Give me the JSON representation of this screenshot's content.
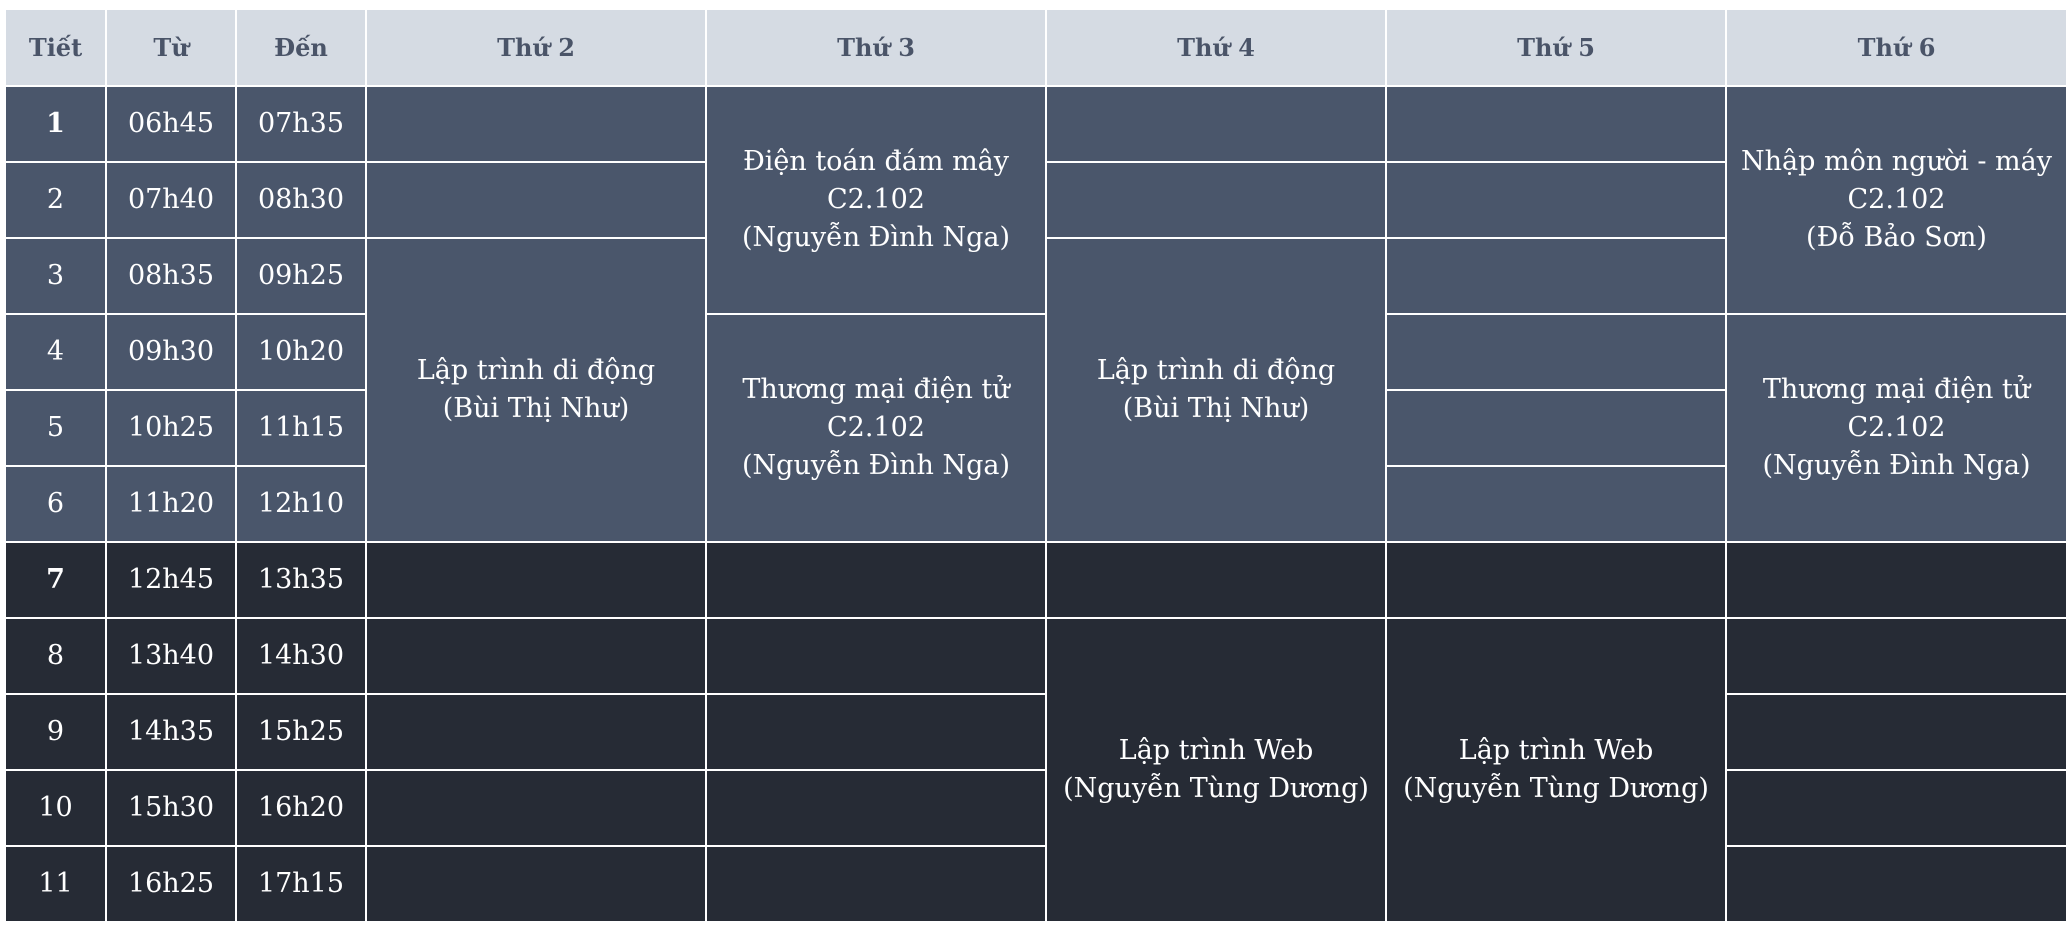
{
  "headers": [
    "Tiết",
    "Từ",
    "Đến",
    "Thứ 2",
    "Thứ 3",
    "Thứ 4",
    "Thứ 5",
    "Thứ 6"
  ],
  "periods": [
    {
      "no": "1",
      "from": "06h45",
      "to": "07h35"
    },
    {
      "no": "2",
      "from": "07h40",
      "to": "08h30"
    },
    {
      "no": "3",
      "from": "08h35",
      "to": "09h25"
    },
    {
      "no": "4",
      "from": "09h30",
      "to": "10h20"
    },
    {
      "no": "5",
      "from": "10h25",
      "to": "11h15"
    },
    {
      "no": "6",
      "from": "11h20",
      "to": "12h10"
    },
    {
      "no": "7",
      "from": "12h45",
      "to": "13h35"
    },
    {
      "no": "8",
      "from": "13h40",
      "to": "14h30"
    },
    {
      "no": "9",
      "from": "14h35",
      "to": "15h25"
    },
    {
      "no": "10",
      "from": "15h30",
      "to": "16h20"
    },
    {
      "no": "11",
      "from": "16h25",
      "to": "17h15"
    }
  ],
  "courses": {
    "mon_mobile": {
      "name": "Lập trình di động",
      "teacher": "(Bùi Thị Như)"
    },
    "tue_cloud": {
      "name": "Điện toán đám mây",
      "room": "C2.102",
      "teacher": "(Nguyễn Đình Nga)"
    },
    "tue_ecom": {
      "name": "Thương mại điện tử",
      "room": "C2.102",
      "teacher": "(Nguyễn Đình Nga)"
    },
    "wed_mobile": {
      "name": "Lập trình di động",
      "teacher": "(Bùi Thị Như)"
    },
    "wed_web": {
      "name": "Lập trình Web",
      "teacher": "(Nguyễn Tùng Dương)"
    },
    "thu_web": {
      "name": "Lập trình Web",
      "teacher": "(Nguyễn Tùng Dương)"
    },
    "fri_hci": {
      "name": "Nhập môn người - máy",
      "room": "C2.102",
      "teacher": "(Đỗ Bảo Sơn)"
    },
    "fri_ecom": {
      "name": "Thương mại điện tử",
      "room": "C2.102",
      "teacher": "(Nguyễn Đình Nga)"
    }
  },
  "colors": {
    "header_bg": "#d5dbe3",
    "header_text": "#4a5468",
    "morning_bg": "#4a566b",
    "afternoon_bg": "#262b35"
  }
}
